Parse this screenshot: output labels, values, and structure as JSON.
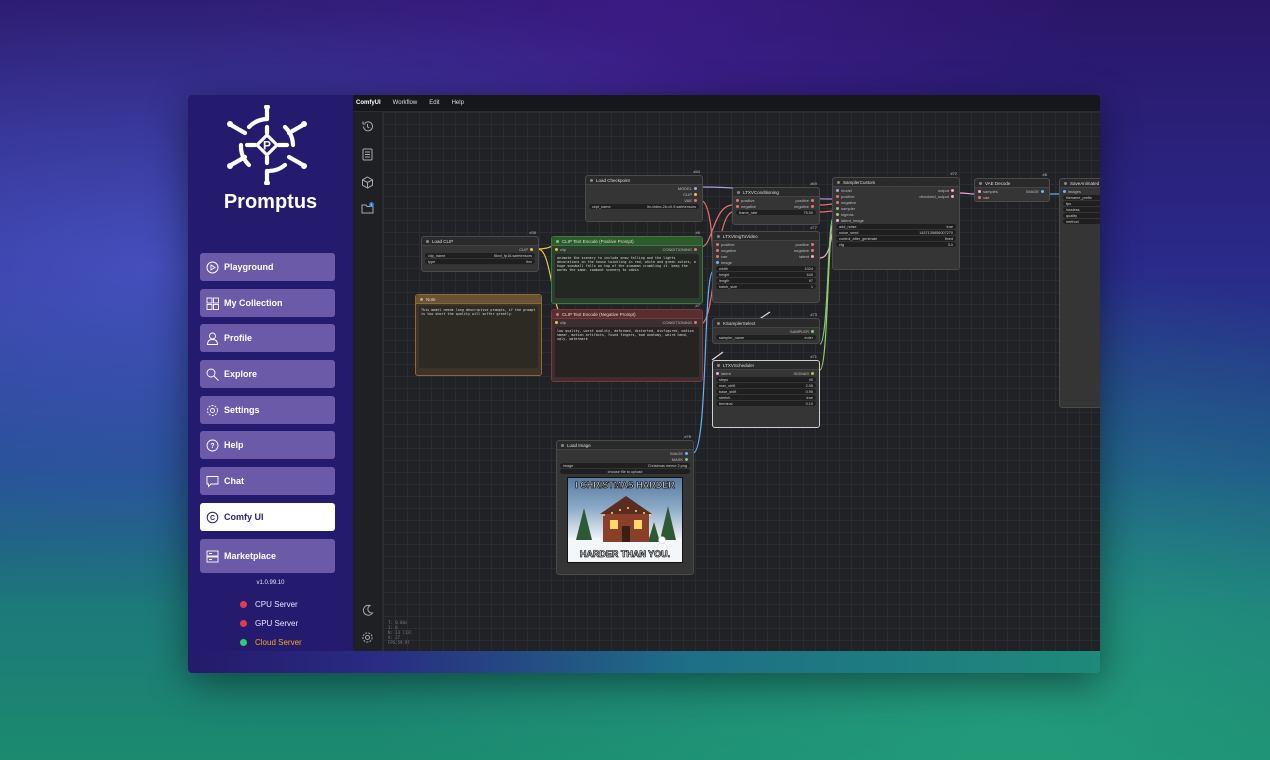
{
  "brand": {
    "name": "Promptus",
    "logo_letter": "P",
    "version": "v1.0.99.10"
  },
  "nav": [
    {
      "label": "Playground",
      "icon": "play-circle-icon"
    },
    {
      "label": "My Collection",
      "icon": "grid-icon"
    },
    {
      "label": "Profile",
      "icon": "user-icon"
    },
    {
      "label": "Explore",
      "icon": "search-icon"
    },
    {
      "label": "Settings",
      "icon": "gear-icon"
    },
    {
      "label": "Help",
      "icon": "question-circle-icon"
    },
    {
      "label": "Chat",
      "icon": "chat-bubble-icon"
    },
    {
      "label": "Comfy UI",
      "icon": "comfy-logo-icon",
      "active": true
    },
    {
      "label": "Marketplace",
      "icon": "server-stack-icon"
    }
  ],
  "servers": [
    {
      "label": "CPU Server",
      "status_color": "#e03b4f"
    },
    {
      "label": "GPU Server",
      "status_color": "#e03b4f"
    },
    {
      "label": "Cloud Server",
      "status_color": "#2fcf6f",
      "label_color": "#f5a623"
    }
  ],
  "comfy": {
    "menu": [
      "ComfyUI",
      "Workflow",
      "Edit",
      "Help"
    ],
    "iconbar_top": [
      "history-icon",
      "queue-list-icon",
      "cube-icon",
      "folder-icon"
    ],
    "iconbar_badge": "1",
    "iconbar_bottom": [
      "moon-icon",
      "gear-icon"
    ],
    "stats": [
      "T: 0.00s",
      "I: 0",
      "N: 13 [13]",
      "V: 27",
      "FPS:59.97"
    ]
  },
  "nodes": {
    "load_checkpoint": {
      "id": "#44",
      "title": "Load Checkpoint",
      "out": [
        "MODEL",
        "CLIP",
        "VAE"
      ],
      "widget_label": "ckpt_name",
      "widget_value": "ltx-video-2b-v0.9.safetensors"
    },
    "load_clip": {
      "id": "#38",
      "title": "Load CLIP",
      "out": "CLIP",
      "w1_label": "clip_name",
      "w1_value": "t5xxl_fp16.safetensors",
      "w2_label": "type",
      "w2_value": "ltxv"
    },
    "note": {
      "title": "Note",
      "text": "This model needs long descriptive prompts, if the prompt is too short the quality will suffer greatly."
    },
    "clip_pos": {
      "id": "#6",
      "title": "CLIP Text Encode (Positive Prompt)",
      "in": "clip",
      "out": "CONDITIONING",
      "text": "animate the scenery to include snow falling and the lights decorations on the house twinkling in red, white and green colors, a huge snowball falls on top of the snowman crumbling it. keep the words the same. zoomout scenery to cabin"
    },
    "clip_neg": {
      "id": "#7",
      "title": "CLIP Text Encode (Negative Prompt)",
      "in": "clip",
      "out": "CONDITIONING",
      "text": "low quality, worst quality, deformed, distorted, disfigured, motion smear, motion artifacts, fused fingers, bad anatomy, weird hand, ugly, watermark"
    },
    "ltxv_cond": {
      "id": "#69",
      "title": "LTXVConditioning",
      "in": [
        "positive",
        "negative"
      ],
      "out": [
        "positive",
        "negative"
      ],
      "w_label": "frame_rate",
      "w_value": "75.00"
    },
    "ltxv_img2vid": {
      "id": "#77",
      "title": "LTXVImgToVideo",
      "in": [
        "positive",
        "negative",
        "vae",
        "image"
      ],
      "out": [
        "positive",
        "negative",
        "latent"
      ],
      "widgets": [
        [
          "width",
          "1024"
        ],
        [
          "height",
          "640"
        ],
        [
          "length",
          "97"
        ],
        [
          "batch_size",
          "1"
        ]
      ]
    },
    "ksampler_select": {
      "id": "#73",
      "title": "KSamplerSelect",
      "out": "SAMPLER",
      "w_label": "sampler_name",
      "w_value": "euler"
    },
    "ltxv_scheduler": {
      "id": "#71",
      "title": "LTXVScheduler",
      "in": "latent",
      "out": "SIGMAS",
      "widgets": [
        [
          "steps",
          "40"
        ],
        [
          "max_shift",
          "2.05"
        ],
        [
          "base_shift",
          "0.95"
        ],
        [
          "stretch",
          "true"
        ],
        [
          "terminal",
          "0.10"
        ]
      ]
    },
    "sampler_custom": {
      "id": "#72",
      "title": "SamplerCustom",
      "in": [
        "model",
        "positive",
        "negative",
        "sampler",
        "sigmas",
        "latent_image"
      ],
      "out": [
        "output",
        "denoised_output"
      ],
      "widgets": [
        [
          "add_noise",
          "true"
        ],
        [
          "noise_seed",
          "1437139856007270"
        ],
        [
          "control_after_generate",
          "fixed"
        ],
        [
          "cfg",
          "3.0"
        ]
      ]
    },
    "vae_decode": {
      "id": "#8",
      "title": "VAE Decode",
      "in": [
        "samples",
        "vae"
      ],
      "out": "IMAGE"
    },
    "save_anim": {
      "title": "SaveAnimated",
      "in": "images",
      "widgets": [
        "filename_prefix",
        "fps",
        "lossless",
        "quality",
        "method"
      ]
    },
    "load_image": {
      "id": "#78",
      "title": "Load Image",
      "out": [
        "IMAGE",
        "MASK"
      ],
      "w_label": "image",
      "w_value": "Christmas meme 2.png",
      "upload_label": "choose file to upload",
      "meme_top": "I CHRISTMAS HARDER",
      "meme_bottom": "HARDER THAN YOU."
    }
  }
}
